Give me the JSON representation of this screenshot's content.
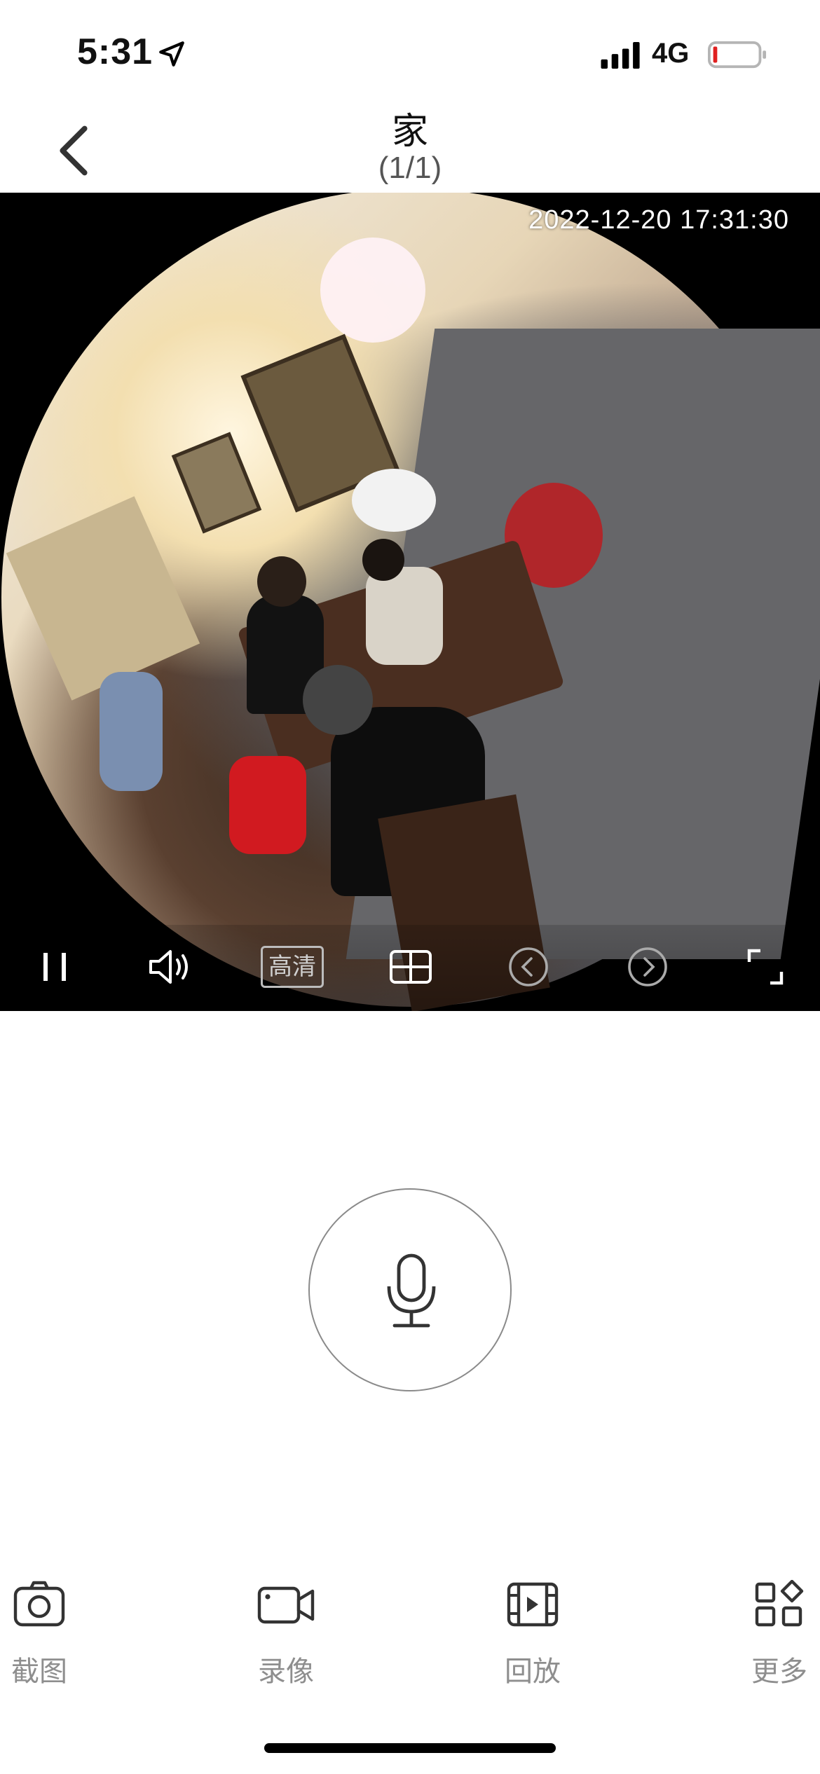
{
  "status_bar": {
    "time": "5:31",
    "network": "4G",
    "location_icon": "location-arrow-icon",
    "signal_icon": "cellular-signal-icon",
    "battery_icon": "battery-low-icon",
    "battery_level": 0.08
  },
  "nav": {
    "title": "家",
    "subtitle": "(1/1)",
    "back_icon": "chevron-left-icon"
  },
  "video": {
    "timestamp": "2022-12-20 17:31:30",
    "controls": {
      "pause_icon": "pause-icon",
      "volume_icon": "speaker-icon",
      "quality_label": "高清",
      "layout_icon": "grid-layout-icon",
      "prev_icon": "chevron-left-circle-icon",
      "next_icon": "chevron-right-circle-icon",
      "fullscreen_icon": "fullscreen-icon"
    }
  },
  "talk": {
    "mic_icon": "microphone-icon"
  },
  "tabs": [
    {
      "label": "截图",
      "icon": "camera-icon"
    },
    {
      "label": "录像",
      "icon": "video-camera-icon"
    },
    {
      "label": "回放",
      "icon": "playback-icon"
    },
    {
      "label": "更多",
      "icon": "more-apps-icon"
    }
  ],
  "colors": {
    "background": "#ffffff",
    "video_background": "#000000",
    "tab_label": "#8e8e8e",
    "battery_low": "#e02020"
  }
}
